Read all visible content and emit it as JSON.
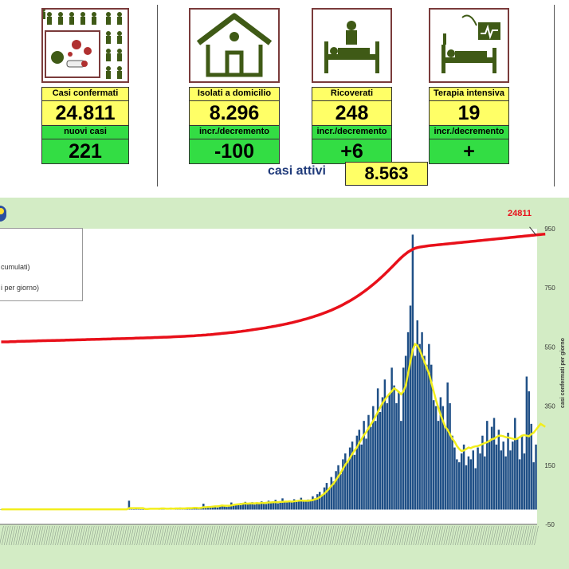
{
  "dashboard": {
    "confirmed": {
      "label": "Casi confermati",
      "value": "24.811",
      "sub_label": "nuovi casi",
      "sub_value": "221"
    },
    "home_isolation": {
      "label": "Isolati a domicilio",
      "value": "8.296",
      "sub_label": "incr./decremento",
      "sub_value": "-100"
    },
    "hospitalized": {
      "label": "Ricoverati",
      "value": "248",
      "sub_label": "incr./decremento",
      "sub_value": "+6"
    },
    "intensive_care": {
      "label": "Terapia intensiva",
      "value": "19",
      "sub_label": "incr./decremento",
      "sub_value": "+"
    },
    "active": {
      "label": "casi attivi",
      "value": "8.563"
    }
  },
  "colors": {
    "panel": "#d3ecc5",
    "bars": "#1f4f86",
    "cumulative": "#e8101a",
    "average": "#f2ee1c",
    "highlight": "#ffff66",
    "green": "#33dd44"
  },
  "chart_data": {
    "type": "bar",
    "title": "",
    "legend": {
      "cumulative_fragment": "cumulati)",
      "daily_fragment": "i per giorno)"
    },
    "cumulative_end_label": "24811",
    "y2label": "casi confermati per giorno",
    "y2ticks": [
      "950",
      "750",
      "550",
      "350",
      "150",
      "-50"
    ],
    "ylim": [
      -50,
      950
    ],
    "daily": [
      1,
      2,
      0,
      1,
      2,
      1,
      0,
      1,
      2,
      1,
      3,
      1,
      0,
      2,
      1,
      1,
      2,
      0,
      1,
      3,
      2,
      1,
      0,
      2,
      1,
      2,
      1,
      0,
      3,
      1,
      2,
      2,
      1,
      1,
      0,
      2,
      1,
      3,
      2,
      1,
      0,
      2,
      1,
      2,
      1,
      1,
      3,
      2,
      0,
      1,
      2,
      1,
      1,
      2,
      0,
      30,
      2,
      1,
      3,
      2,
      1,
      0,
      2,
      5,
      3,
      2,
      4,
      3,
      1,
      6,
      3,
      2,
      4,
      3,
      5,
      2,
      3,
      7,
      4,
      3,
      5,
      8,
      4,
      6,
      5,
      3,
      7,
      20,
      8,
      6,
      10,
      12,
      9,
      7,
      14,
      16,
      11,
      9,
      13,
      24,
      18,
      20,
      15,
      22,
      19,
      26,
      18,
      21,
      25,
      17,
      23,
      20,
      28,
      24,
      19,
      30,
      22,
      26,
      33,
      21,
      27,
      38,
      25,
      24,
      30,
      28,
      35,
      26,
      32,
      40,
      29,
      27,
      34,
      31,
      45,
      38,
      52,
      60,
      48,
      75,
      90,
      68,
      110,
      95,
      130,
      150,
      120,
      170,
      190,
      160,
      210,
      230,
      185,
      250,
      270,
      220,
      300,
      240,
      320,
      280,
      350,
      300,
      410,
      330,
      380,
      440,
      360,
      390,
      480,
      420,
      360,
      400,
      300,
      480,
      520,
      600,
      690,
      930,
      520,
      640,
      560,
      600,
      520,
      490,
      560,
      490,
      370,
      350,
      300,
      380,
      350,
      280,
      430,
      360,
      250,
      210,
      170,
      160,
      190,
      220,
      150,
      180,
      170,
      200,
      140,
      210,
      190,
      250,
      180,
      300,
      230,
      280,
      310,
      220,
      270,
      200,
      230,
      180,
      260,
      200,
      230,
      310,
      240,
      170,
      250,
      190,
      450,
      400,
      290,
      160,
      220
    ],
    "moving_average": [
      1,
      1,
      1,
      1,
      1,
      1,
      1,
      1,
      1,
      1,
      1,
      1,
      1,
      1,
      1,
      1,
      1,
      1,
      1,
      1,
      1,
      1,
      1,
      1,
      1,
      1,
      1,
      1,
      1,
      1,
      1,
      1,
      1,
      1,
      1,
      1,
      1,
      1,
      1,
      1,
      1,
      1,
      1,
      1,
      1,
      1,
      1,
      1,
      1,
      1,
      1,
      1,
      1,
      1,
      1,
      5,
      5,
      5,
      5,
      5,
      5,
      5,
      2,
      2,
      3,
      3,
      3,
      3,
      3,
      4,
      4,
      3,
      3,
      4,
      3,
      4,
      4,
      4,
      4,
      4,
      5,
      5,
      5,
      6,
      6,
      5,
      6,
      8,
      8,
      9,
      9,
      10,
      11,
      11,
      12,
      14,
      13,
      13,
      13,
      14,
      16,
      17,
      18,
      18,
      20,
      21,
      20,
      21,
      21,
      21,
      22,
      21,
      23,
      22,
      23,
      24,
      24,
      25,
      25,
      25,
      26,
      26,
      27,
      27,
      28,
      27,
      28,
      29,
      30,
      31,
      30,
      30,
      30,
      31,
      32,
      35,
      37,
      42,
      48,
      54,
      62,
      70,
      80,
      88,
      100,
      112,
      124,
      138,
      152,
      162,
      175,
      188,
      200,
      210,
      225,
      238,
      252,
      262,
      275,
      288,
      300,
      315,
      330,
      345,
      360,
      372,
      382,
      392,
      400,
      410,
      405,
      398,
      390,
      400,
      420,
      460,
      500,
      540,
      560,
      555,
      540,
      520,
      500,
      480,
      460,
      430,
      400,
      370,
      345,
      320,
      300,
      280,
      270,
      255,
      240,
      230,
      215,
      205,
      198,
      200,
      205,
      210,
      208,
      212,
      214,
      215,
      218,
      222,
      225,
      228,
      232,
      238,
      240,
      245,
      250,
      250,
      248,
      245,
      244,
      242,
      240,
      238,
      240,
      245,
      250,
      252,
      250,
      248,
      255,
      260,
      270,
      280,
      290,
      285,
      280
    ],
    "cumulative": [
      15600,
      15600,
      15600,
      15600,
      15620,
      15620,
      15620,
      15640,
      15640,
      15650,
      15650,
      15660,
      15660,
      15670,
      15680,
      15680,
      15690,
      15690,
      15700,
      15700,
      15710,
      15710,
      15720,
      15720,
      15730,
      15730,
      15740,
      15740,
      15750,
      15750,
      15760,
      15760,
      15770,
      15780,
      15780,
      15790,
      15790,
      15800,
      15800,
      15810,
      15810,
      15820,
      15820,
      15830,
      15840,
      15840,
      15850,
      15850,
      15860,
      15860,
      15870,
      15870,
      15880,
      15880,
      15890,
      15900,
      15900,
      15910,
      15920,
      15920,
      15930,
      15930,
      15940,
      15950,
      15950,
      15960,
      15970,
      15970,
      15980,
      15990,
      16000,
      16000,
      16010,
      16020,
      16030,
      16040,
      16050,
      16060,
      16070,
      16080,
      16090,
      16100,
      16110,
      16120,
      16140,
      16150,
      16160,
      16180,
      16190,
      16210,
      16220,
      16240,
      16260,
      16280,
      16300,
      16320,
      16340,
      16360,
      16380,
      16400,
      16420,
      16440,
      16470,
      16490,
      16520,
      16540,
      16570,
      16600,
      16630,
      16660,
      16690,
      16720,
      16750,
      16780,
      16810,
      16850,
      16880,
      16920,
      16950,
      16990,
      17030,
      17070,
      17110,
      17150,
      17200,
      17240,
      17290,
      17340,
      17390,
      17440,
      17500,
      17550,
      17610,
      17670,
      17730,
      17800,
      17860,
      17930,
      18000,
      18080,
      18150,
      18230,
      18310,
      18400,
      18490,
      18580,
      18680,
      18780,
      18890,
      19000,
      19110,
      19230,
      19350,
      19480,
      19610,
      19750,
      19890,
      20040,
      20190,
      20350,
      20510,
      20680,
      20850,
      21030,
      21210,
      21400,
      21590,
      21790,
      21990,
      22190,
      22400,
      22600,
      22790,
      22970,
      23130,
      23280,
      23400,
      23510,
      23600,
      23660,
      23700,
      23730,
      23760,
      23790,
      23820,
      23840,
      23860,
      23880,
      23900,
      23920,
      23940,
      23960,
      23980,
      24000,
      24020,
      24040,
      24060,
      24080,
      24100,
      24120,
      24140,
      24160,
      24180,
      24200,
      24220,
      24240,
      24260,
      24280,
      24300,
      24320,
      24340,
      24360,
      24380,
      24400,
      24420,
      24440,
      24460,
      24480,
      24500,
      24520,
      24540,
      24560,
      24580,
      24600,
      24620,
      24640,
      24660,
      24680,
      24700,
      24720,
      24740,
      24760,
      24780,
      24800,
      24811
    ],
    "series": [
      {
        "values_key": "daily"
      },
      {
        "values_key": "moving_average"
      },
      {
        "values_key": "cumulative"
      }
    ],
    "grid": false
  }
}
